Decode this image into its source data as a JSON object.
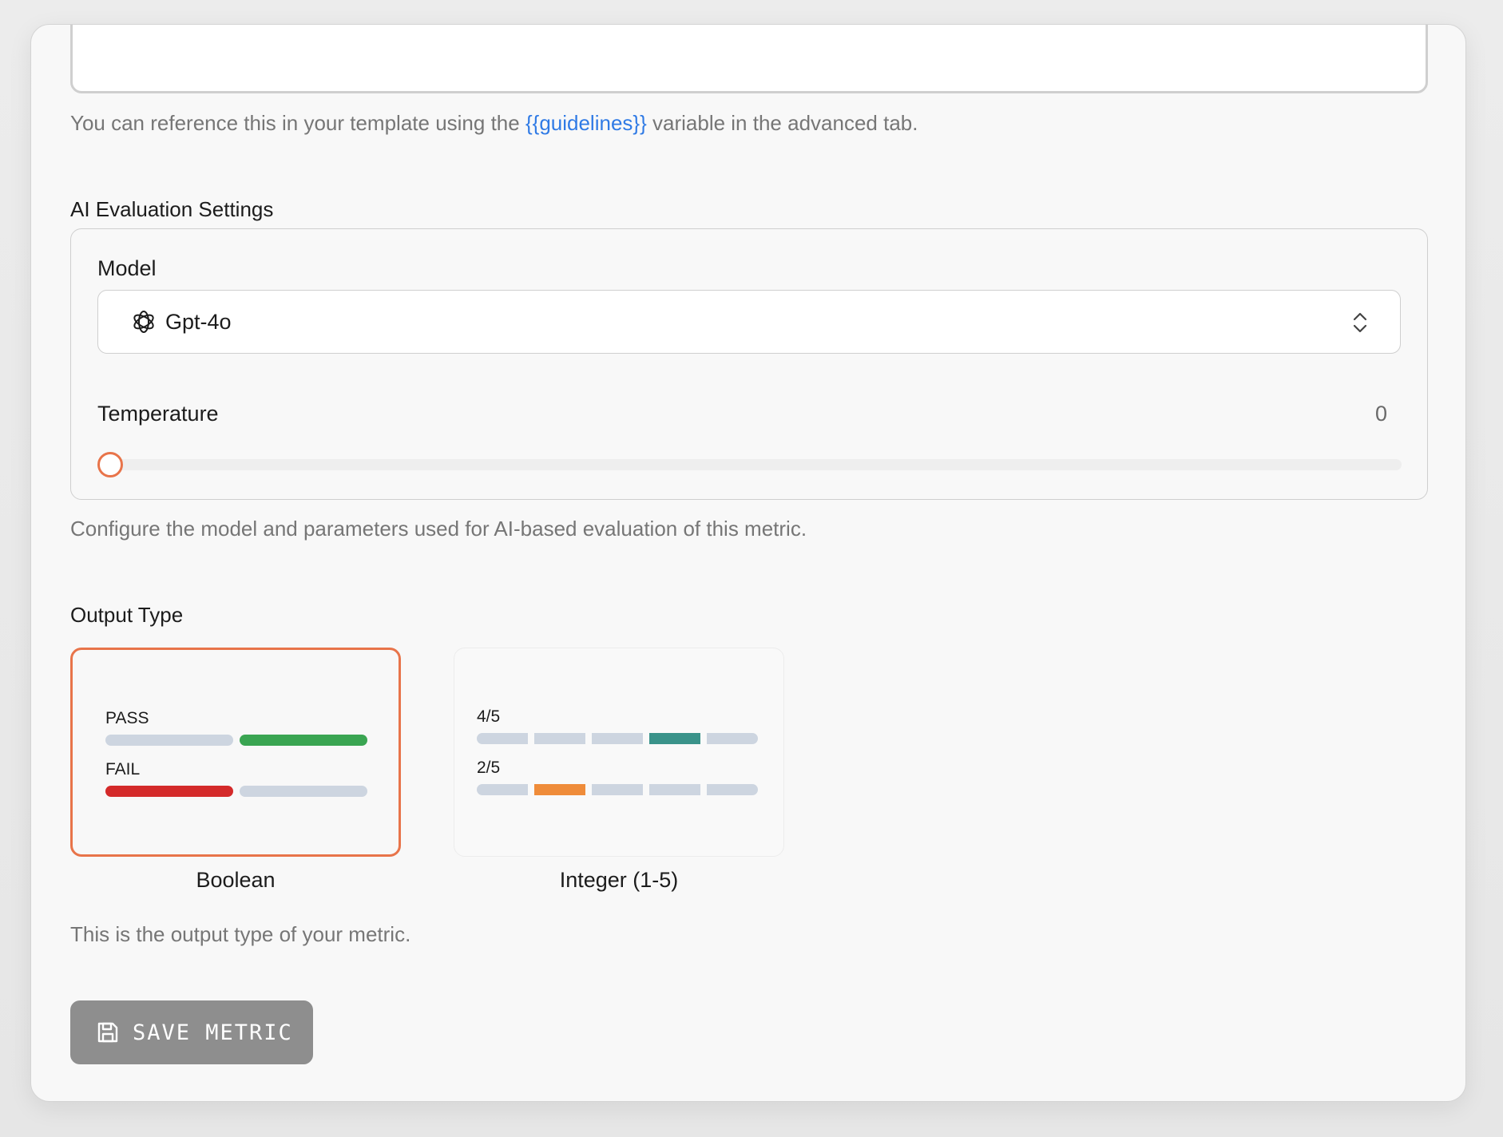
{
  "guidelines": {
    "helper_prefix": "You can reference this in your template using the ",
    "variable": "{{guidelines}}",
    "helper_suffix": " variable in the advanced tab."
  },
  "ai_settings": {
    "section_label": "AI Evaluation Settings",
    "model_label": "Model",
    "model_value": "Gpt-4o",
    "model_icon": "openai-logo-icon",
    "temperature_label": "Temperature",
    "temperature_value": "0",
    "temperature_level": 0,
    "helper": "Configure the model and parameters used for AI-based evaluation of this metric."
  },
  "output_type": {
    "section_label": "Output Type",
    "options": [
      {
        "caption": "Boolean",
        "selected": true,
        "rows": [
          {
            "label": "PASS",
            "segments": 2,
            "filled_index": 1,
            "fill_color": "#3aa552"
          },
          {
            "label": "FAIL",
            "segments": 2,
            "filled_index": 0,
            "fill_color": "#d42a2a"
          }
        ]
      },
      {
        "caption": "Integer (1-5)",
        "selected": false,
        "rows": [
          {
            "label": "4/5",
            "segments": 5,
            "filled_index": 3,
            "fill_color": "#3a938a"
          },
          {
            "label": "2/5",
            "segments": 5,
            "filled_index": 1,
            "fill_color": "#ef8c3a"
          }
        ]
      }
    ],
    "helper": "This is the output type of your metric."
  },
  "actions": {
    "save_label": "SAVE METRIC",
    "save_icon": "floppy-disk-icon"
  },
  "colors": {
    "accent": "#e8744a",
    "link": "#2f7ae5",
    "button_bg": "#8e8e8e"
  }
}
